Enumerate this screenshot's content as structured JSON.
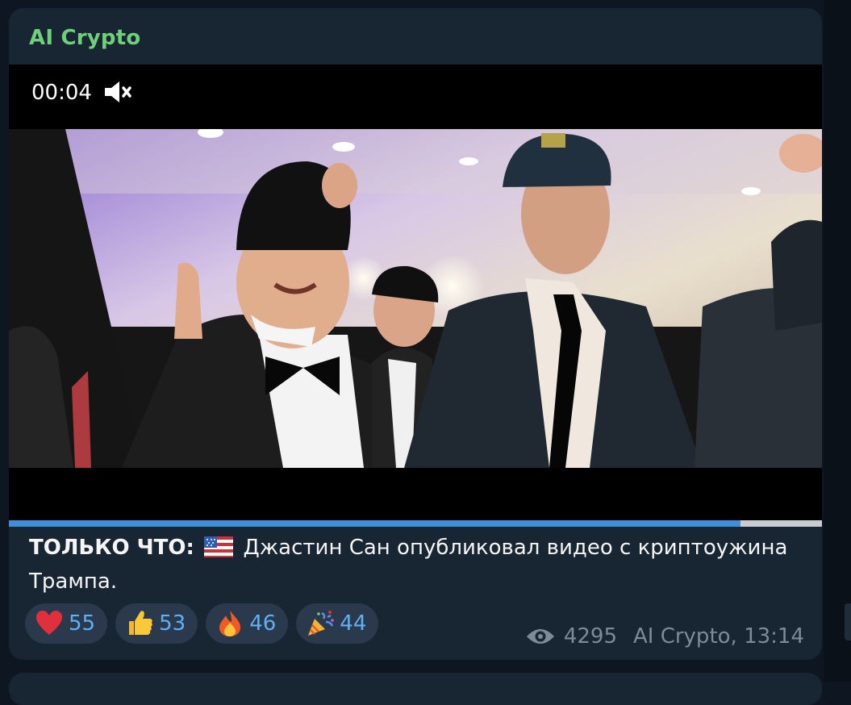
{
  "message": {
    "channel_name": "AI Crypto",
    "video": {
      "time": "00:04",
      "sound_icon": "speaker-muted-icon",
      "progress_fraction": 0.9
    },
    "caption": {
      "lead": "ТОЛЬКО ЧТО:",
      "flag_icon": "us-flag-icon",
      "text": "Джастин Сан опубликовал видео с криптоужина Трампа."
    },
    "reactions": [
      {
        "emoji": "heart-icon",
        "count": "55"
      },
      {
        "emoji": "thumbs-up-icon",
        "count": "53"
      },
      {
        "emoji": "fire-icon",
        "count": "46"
      },
      {
        "emoji": "party-popper-icon",
        "count": "44"
      }
    ],
    "views": "4295",
    "signature": "AI Crypto, 13:14"
  },
  "colors": {
    "channel_name": "#6fd07a",
    "bubble": "#182533",
    "reaction_count": "#5fb0f5",
    "progress": "#3f8ed9"
  }
}
